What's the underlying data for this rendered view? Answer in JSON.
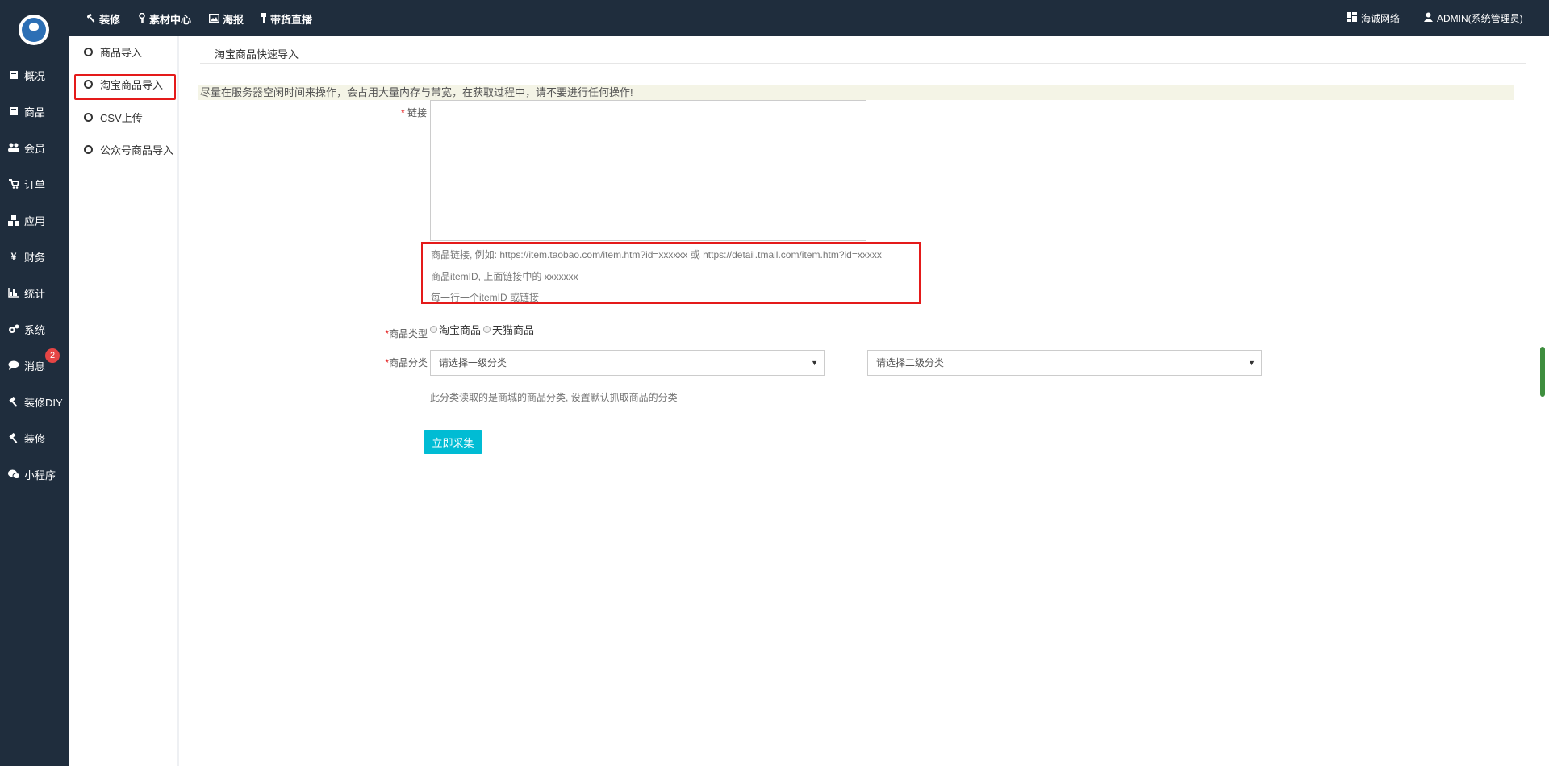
{
  "colors": {
    "sidebar_bg": "#1f2d3d",
    "accent": "#00bcd4",
    "highlight": "#e41a1a",
    "badge": "#e64545"
  },
  "topbar": {
    "links": [
      {
        "label": "装修",
        "icon": "hammer-icon"
      },
      {
        "label": "素材中心",
        "icon": "key-icon"
      },
      {
        "label": "海报",
        "icon": "image-icon"
      },
      {
        "label": "带货直播",
        "icon": "pin-icon"
      }
    ],
    "right": [
      {
        "label": "海诚网络",
        "icon": "grid-icon"
      },
      {
        "label": "ADMIN(系统管理员)",
        "icon": "user-icon"
      }
    ]
  },
  "sidebar": {
    "items": [
      {
        "label": "概况",
        "icon": "book-icon"
      },
      {
        "label": "商品",
        "icon": "book-icon"
      },
      {
        "label": "会员",
        "icon": "users-icon"
      },
      {
        "label": "订单",
        "icon": "cart-icon"
      },
      {
        "label": "应用",
        "icon": "cubes-icon"
      },
      {
        "label": "财务",
        "icon": "yen-icon"
      },
      {
        "label": "统计",
        "icon": "bar-chart-icon"
      },
      {
        "label": "系统",
        "icon": "gears-icon"
      },
      {
        "label": "消息",
        "icon": "comment-icon"
      },
      {
        "label": "装修DIY",
        "icon": "hammer-icon"
      },
      {
        "label": "装修",
        "icon": "hammer-icon"
      },
      {
        "label": "小程序",
        "icon": "wechat-icon"
      }
    ],
    "message_badge": "2"
  },
  "subnav": {
    "items": [
      {
        "label": "商品导入"
      },
      {
        "label": "淘宝商品导入"
      },
      {
        "label": "CSV上传"
      },
      {
        "label": "公众号商品导入"
      }
    ]
  },
  "main": {
    "tab": "淘宝商品快速导入",
    "notice": "尽量在服务器空闲时间来操作，会占用大量内存与带宽，在获取过程中，请不要进行任何操作!",
    "link_label": "链接",
    "required_mark": "*",
    "hints": [
      "商品链接, 例如: https://item.taobao.com/item.htm?id=xxxxxx 或 https://detail.tmall.com/item.htm?id=xxxxx",
      "商品itemID, 上面链接中的 xxxxxxx",
      "每一行一个itemID 或链接"
    ],
    "type_label": "商品类型",
    "type_options": [
      "淘宝商品",
      "天猫商品"
    ],
    "category_label": "商品分类",
    "category1_placeholder": "请选择一级分类",
    "category2_placeholder": "请选择二级分类",
    "category_note": "此分类读取的是商城的商品分类, 设置默认抓取商品的分类",
    "submit_label": "立即采集"
  }
}
